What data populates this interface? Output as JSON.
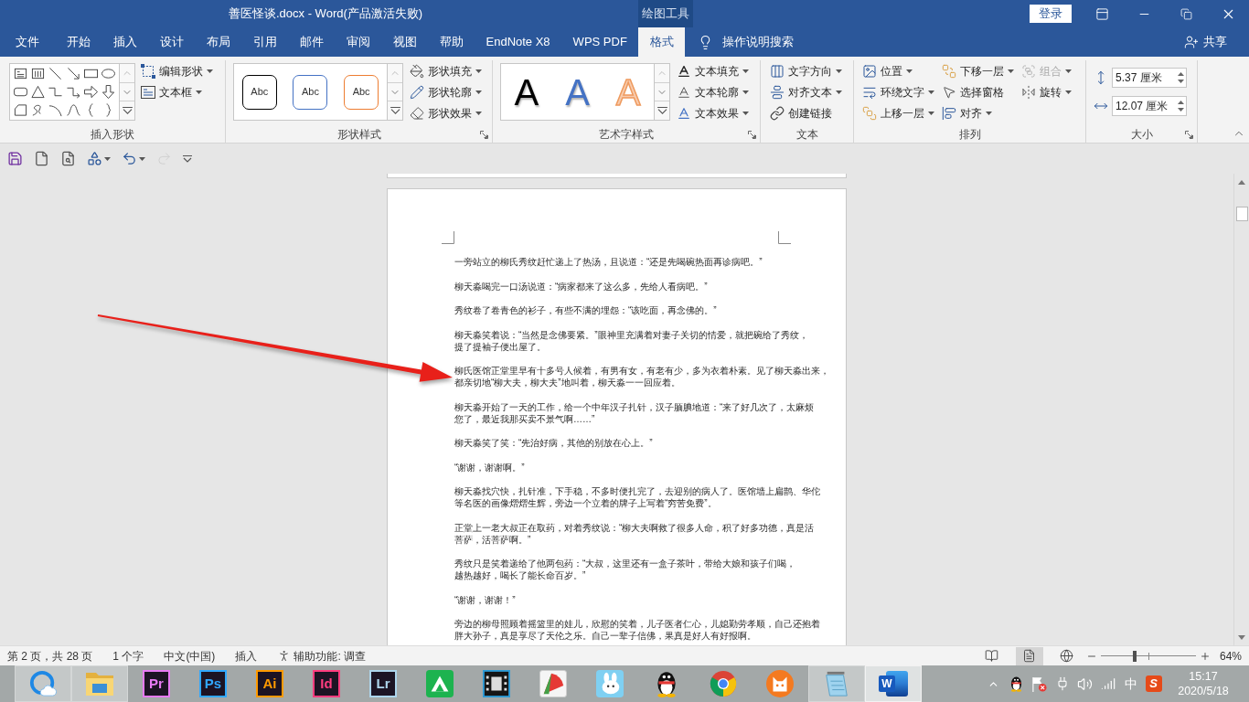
{
  "window": {
    "title": "善医怪谈.docx - Word(产品激活失败)",
    "context_tab": "绘图工具",
    "sign_in": "登录"
  },
  "tabs": [
    {
      "label": "文件",
      "kind": "backstage",
      "selected": false
    },
    {
      "label": "开始",
      "kind": "tab",
      "selected": false
    },
    {
      "label": "插入",
      "kind": "tab",
      "selected": false
    },
    {
      "label": "设计",
      "kind": "tab",
      "selected": false
    },
    {
      "label": "布局",
      "kind": "tab",
      "selected": false
    },
    {
      "label": "引用",
      "kind": "tab",
      "selected": false
    },
    {
      "label": "邮件",
      "kind": "tab",
      "selected": false
    },
    {
      "label": "审阅",
      "kind": "tab",
      "selected": false
    },
    {
      "label": "视图",
      "kind": "tab",
      "selected": false
    },
    {
      "label": "帮助",
      "kind": "tab",
      "selected": false
    },
    {
      "label": "EndNote X8",
      "kind": "tab",
      "selected": false
    },
    {
      "label": "WPS PDF",
      "kind": "tab",
      "selected": false
    },
    {
      "label": "格式",
      "kind": "tab",
      "selected": true
    }
  ],
  "tell_me": {
    "label": "操作说明搜索"
  },
  "share": {
    "label": "共享"
  },
  "ribbon": {
    "groups": [
      {
        "kind": "insert_shapes",
        "label": "插入形状",
        "launcher": false,
        "buttons": [
          {
            "label": "编辑形状",
            "dropdown": true
          },
          {
            "label": "文本框",
            "dropdown": true
          }
        ]
      },
      {
        "kind": "shape_styles",
        "label": "形状样式",
        "launcher": true,
        "presets": [
          {
            "label": "Abc",
            "color": "#000000"
          },
          {
            "label": "Abc",
            "color": "#4472c4"
          },
          {
            "label": "Abc",
            "color": "#ed7d31"
          }
        ],
        "buttons": [
          {
            "label": "形状填充",
            "dropdown": true
          },
          {
            "label": "形状轮廓",
            "dropdown": true
          },
          {
            "label": "形状效果",
            "dropdown": true
          }
        ]
      },
      {
        "kind": "wordart_styles",
        "label": "艺术字样式",
        "launcher": true,
        "presets": [
          {
            "label": "A",
            "color": "#000000",
            "outline": false
          },
          {
            "label": "A",
            "color": "#4472c4",
            "outline": false
          },
          {
            "label": "A",
            "color": "#f8cbad",
            "outline": true
          }
        ],
        "buttons": [
          {
            "label": "文本填充",
            "dropdown": true
          },
          {
            "label": "文本轮廓",
            "dropdown": true
          },
          {
            "label": "文本效果",
            "dropdown": true
          }
        ]
      },
      {
        "kind": "text",
        "label": "文本",
        "launcher": false,
        "buttons": [
          {
            "label": "文字方向",
            "dropdown": true
          },
          {
            "label": "对齐文本",
            "dropdown": true
          },
          {
            "label": "创建链接",
            "dropdown": false
          }
        ]
      },
      {
        "kind": "arrange",
        "label": "排列",
        "launcher": false,
        "buttons": [
          {
            "label": "位置",
            "dropdown": true,
            "disabled": false
          },
          {
            "label": "环绕文字",
            "dropdown": true,
            "disabled": false
          },
          {
            "label": "上移一层",
            "dropdown": true,
            "disabled": false
          },
          {
            "label": "下移一层",
            "dropdown": true,
            "disabled": false
          },
          {
            "label": "选择窗格",
            "dropdown": false,
            "disabled": false
          },
          {
            "label": "对齐",
            "dropdown": true,
            "disabled": false
          },
          {
            "label": "组合",
            "dropdown": true,
            "disabled": true
          },
          {
            "label": "旋转",
            "dropdown": true,
            "disabled": false
          }
        ]
      },
      {
        "kind": "size",
        "label": "大小",
        "launcher": true,
        "fields": [
          {
            "kind": "height",
            "value": "5.37 厘米"
          },
          {
            "kind": "width",
            "value": "12.07 厘米"
          }
        ]
      }
    ]
  },
  "quick_access": [
    {
      "kind": "save",
      "dropdown": false,
      "disabled": false
    },
    {
      "kind": "new",
      "dropdown": false,
      "disabled": false
    },
    {
      "kind": "preview",
      "dropdown": false,
      "disabled": false
    },
    {
      "kind": "shapes",
      "dropdown": true,
      "disabled": false
    },
    {
      "kind": "undo",
      "dropdown": true,
      "disabled": false
    },
    {
      "kind": "redo",
      "dropdown": false,
      "disabled": true
    },
    {
      "kind": "customize",
      "dropdown": false,
      "disabled": false
    }
  ],
  "document": {
    "paragraphs": [
      {
        "lines": [
          "一旁站立的柳氏秀纹赶忙递上了热汤，且说道：“还是先喝碗热面再诊病吧。”"
        ]
      },
      {
        "lines": [
          "柳天淼喝完一口汤说道：“病家都来了这么多，先给人看病吧。”"
        ]
      },
      {
        "lines": [
          "秀纹卷了卷青色的衫子，有些不满的埋怨：“该吃面，再念佛的。”"
        ]
      },
      {
        "lines": [
          "柳天淼笑着说：“当然是念佛要紧。”眼神里充满着对妻子关切的情爱，就把碗给了秀纹，",
          "提了提袖子便出屋了。"
        ]
      },
      {
        "lines": [
          "柳氏医馆正堂里早有十多号人候着，有男有女，有老有少，多为衣着朴素。见了柳天淼出来，",
          "都亲切地“柳大夫，柳大夫”地叫着，柳天淼一一回应着。"
        ]
      },
      {
        "lines": [
          "柳天淼开始了一天的工作，给一个中年汉子扎针，汉子腼腆地道：“来了好几次了，太麻烦",
          "您了，最近我那买卖不景气啊……”"
        ]
      },
      {
        "lines": [
          "柳天淼笑了笑：“先治好病，其他的别放在心上。”"
        ]
      },
      {
        "lines": [
          "“谢谢，谢谢啊。”"
        ]
      },
      {
        "lines": [
          "柳天淼找穴快，扎针准，下手稳，不多时便扎完了，去迎别的病人了。医馆墙上扁鹊、华佗",
          "等名医的画像熠熠生辉，旁边一个立着的牌子上写着“穷苦免费”。"
        ]
      },
      {
        "lines": [
          "正堂上一老大叔正在取药，对着秀纹说：“柳大夫啊救了很多人命，积了好多功德，真是活",
          "菩萨，活菩萨啊。”"
        ]
      },
      {
        "lines": [
          "秀纹只是笑着递给了他两包药：“大叔，这里还有一盒子茶叶，带给大娘和孩子们喝，",
          "越热越好，喝长了能长命百岁。”"
        ]
      },
      {
        "lines": [
          "“谢谢，谢谢！”"
        ]
      },
      {
        "lines": [
          "旁边的柳母照顾着摇篮里的娃儿，欣慰的笑着，儿子医者仁心，儿媳勤劳孝顺，自己还抱着",
          "胖大孙子，真是享尽了天伦之乐。自己一辈子信佛，果真是好人有好报啊。"
        ]
      }
    ]
  },
  "status_bar": {
    "items": [
      {
        "label": "第 2 页，共 28 页"
      },
      {
        "label": "1 个字"
      },
      {
        "label": "中文(中国)"
      },
      {
        "label": "插入"
      }
    ],
    "accessibility": {
      "label": "辅助功能: 调查"
    },
    "views": [
      {
        "kind": "read",
        "selected": false
      },
      {
        "kind": "print",
        "selected": true
      },
      {
        "kind": "web",
        "selected": false
      }
    ],
    "zoom": {
      "level": 0.36,
      "reading": "64%"
    }
  },
  "taskbar": {
    "apps": [
      {
        "kind": "qq_browser",
        "open": true,
        "selected": false
      },
      {
        "kind": "folder",
        "open": true,
        "selected": false
      },
      {
        "kind": "adobe",
        "label": "Pr",
        "color": "#e77bf3",
        "open": false,
        "selected": false
      },
      {
        "kind": "adobe",
        "label": "Ps",
        "color": "#31a8ff",
        "open": false,
        "selected": false
      },
      {
        "kind": "adobe",
        "label": "Ai",
        "color": "#ff9a00",
        "open": false,
        "selected": false
      },
      {
        "kind": "adobe",
        "label": "Id",
        "color": "#ff3d7f",
        "open": false,
        "selected": false
      },
      {
        "kind": "adobe",
        "label": "Lr",
        "color": "#add5ec",
        "open": false,
        "selected": false
      },
      {
        "kind": "green_tile",
        "open": false,
        "selected": false
      },
      {
        "kind": "film",
        "open": false,
        "selected": false
      },
      {
        "kind": "wedge",
        "open": false,
        "selected": false
      },
      {
        "kind": "cartoon",
        "open": false,
        "selected": false
      },
      {
        "kind": "penguin",
        "open": false,
        "selected": false
      },
      {
        "kind": "segmented_circle",
        "open": false,
        "selected": false
      },
      {
        "kind": "cat",
        "open": false,
        "selected": false
      },
      {
        "kind": "notepad",
        "open": true,
        "selected": false
      },
      {
        "kind": "word",
        "label": "W",
        "open": true,
        "selected": true
      }
    ],
    "tray": [
      {
        "kind": "caret"
      },
      {
        "kind": "qq"
      },
      {
        "kind": "flag"
      },
      {
        "kind": "power"
      },
      {
        "kind": "volume"
      },
      {
        "kind": "signal"
      },
      {
        "kind": "ime",
        "label": "中"
      },
      {
        "kind": "sogou",
        "label": "S"
      }
    ],
    "clock": {
      "time": "15:17",
      "date": "2020/5/18"
    }
  },
  "annotations": [
    {
      "kind": "arrow"
    }
  ]
}
